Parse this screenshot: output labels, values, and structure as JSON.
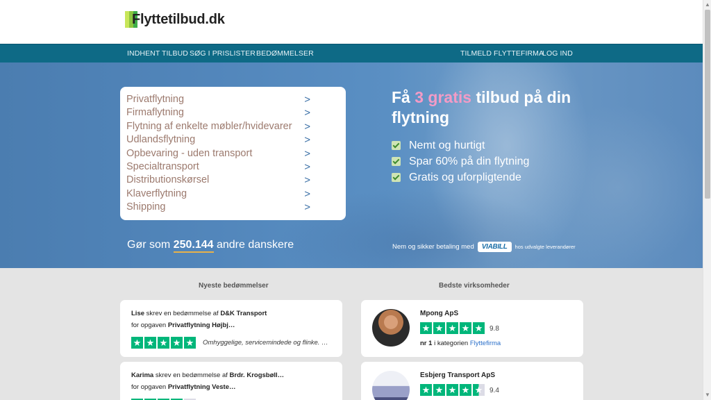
{
  "brand": {
    "name": "Flyttetilbud.dk"
  },
  "nav": {
    "left": [
      "INDHENT TILBUD",
      "SØG I PRISLISTER",
      "BEDØMMELSER"
    ],
    "right": [
      "TILMELD FLYTTEFIRMA",
      "LOG IND"
    ]
  },
  "hero": {
    "menu": [
      "Privatflytning",
      "Firmaflytning",
      "Flytning af enkelte møbler/hvidevarer",
      "Udlandsflytning",
      "Opbevaring - uden transport",
      "Specialtransport",
      "Distributionskørsel",
      "Klaverflytning",
      "Shipping"
    ],
    "menu_arrow": ">",
    "title_before": "Få ",
    "title_highlight": "3 gratis",
    "title_after": " tilbud på din flytning",
    "benefits": [
      "Nemt og hurtigt",
      "Spar 60% på din flytning",
      "Gratis og uforpligtende"
    ],
    "counter_before": "Gør som ",
    "counter_number": "250.144",
    "counter_after": " andre danskere",
    "payment_text": "Nem og sikker betaling med",
    "payment_brand": "VIABILL",
    "payment_suffix": "hos udvalgte leverandører"
  },
  "reviews": {
    "title": "Nyeste bedømmelser",
    "items": [
      {
        "name": "Lise",
        "mid": " skrev en bedømmelse af ",
        "company": "D&K Transport",
        "job_prefix": "for opgaven ",
        "job": "Privatflytning Højbj…",
        "stars": 5,
        "quote": "Omhyggelige, servicemindede og flinke. …"
      },
      {
        "name": "Karima",
        "mid": " skrev en bedømmelse af ",
        "company": "Brdr. Krogsbøll…",
        "job_prefix": "for opgaven ",
        "job": "Privatflytning Veste…",
        "stars": 4,
        "quote": ""
      }
    ]
  },
  "firms": {
    "title": "Bedste virksomheder",
    "items": [
      {
        "name": "Mpong ApS",
        "score": "9.8",
        "stars": 5,
        "rank_label": "nr 1",
        "rank_text": " i kategorien ",
        "category": "Flyttefirma"
      },
      {
        "name": "Esbjerg Transport ApS",
        "score": "9.4",
        "stars": 4.5
      }
    ]
  }
}
